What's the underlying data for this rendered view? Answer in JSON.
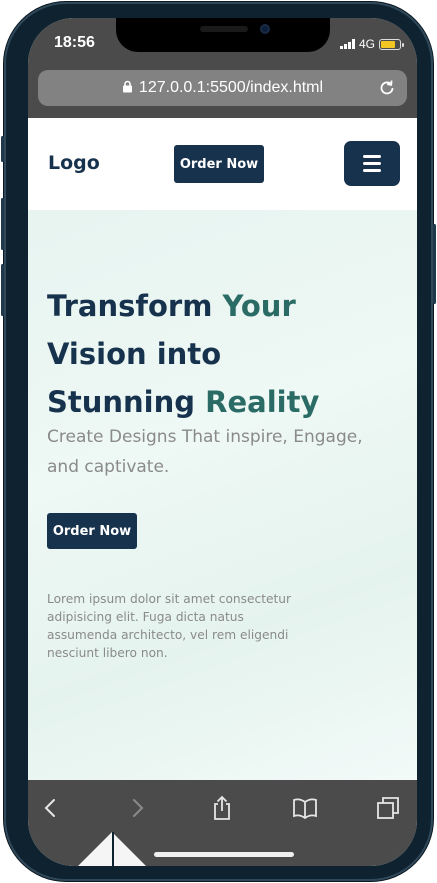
{
  "status_bar": {
    "time": "18:56",
    "network": "4G",
    "battery_color": "#f3c623"
  },
  "browser": {
    "url": "127.0.0.1:5500/index.html",
    "icons": {
      "lock": "lock-icon",
      "reload": "reload-icon",
      "back": "chevron-left-icon",
      "forward": "chevron-right-icon",
      "share": "share-icon",
      "bookmarks": "book-icon",
      "tabs": "tabs-icon"
    }
  },
  "header": {
    "logo": "Logo",
    "order_label": "Order Now",
    "menu_icon": "hamburger-icon"
  },
  "hero": {
    "title_line1_part1": "Transform ",
    "title_line1_part2": "Your",
    "title_line2": "Vision into",
    "title_line3_part1": "Stunning ",
    "title_line3_part2": "Reality",
    "subtitle": "Create Designs That inspire, Engage, and captivate.",
    "order_label": "Order Now",
    "paragraph": "Lorem ipsum dolor sit amet consectetur adipisicing elit. Fuga dicta natus assumenda architecto, vel rem eligendi nesciunt libero non."
  },
  "colors": {
    "primary": "#17324d",
    "accent": "#2b6b66",
    "muted_text": "#8a8a8a",
    "browser_chrome": "#4b4b4b",
    "hero_bg": "#e9f5f1"
  }
}
